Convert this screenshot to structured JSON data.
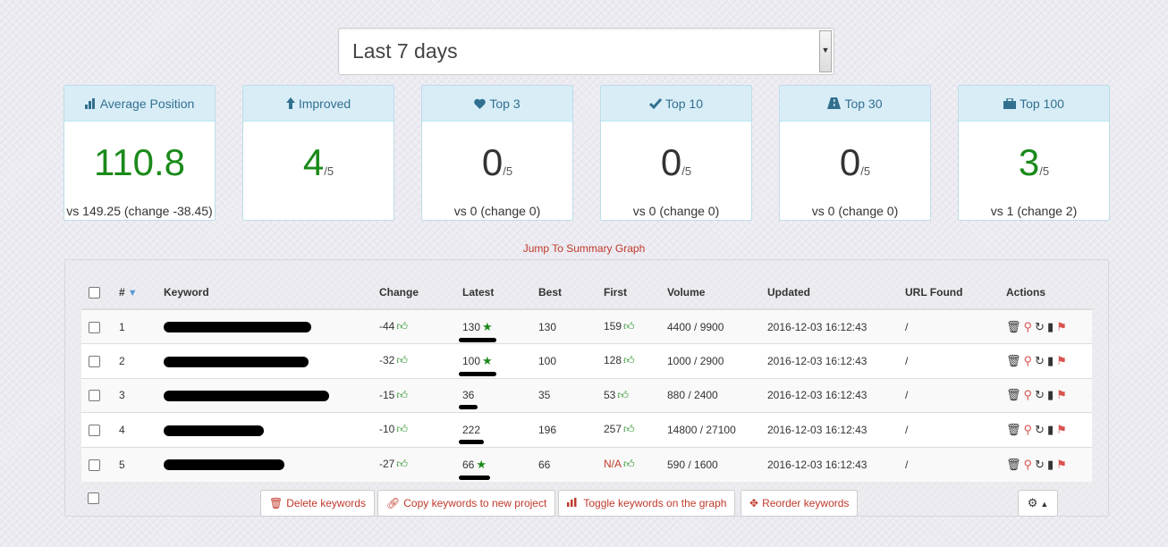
{
  "range": {
    "value": "Last 7 days"
  },
  "cards": [
    {
      "title": "Average Position",
      "icon": "bar-chart-icon",
      "value": "110.8",
      "denom": "",
      "sub": "vs 149.25 (change -38.45)",
      "color": "#1a8a1a"
    },
    {
      "title": "Improved",
      "icon": "arrow-up-icon",
      "value": "4",
      "denom": "/5",
      "sub": "",
      "color": "#1a8a1a"
    },
    {
      "title": "Top 3",
      "icon": "heart-icon",
      "value": "0",
      "denom": "/5",
      "sub": "vs 0 (change 0)",
      "color": "#333333"
    },
    {
      "title": "Top 10",
      "icon": "check-icon",
      "value": "0",
      "denom": "/5",
      "sub": "vs 0 (change 0)",
      "color": "#333333"
    },
    {
      "title": "Top 30",
      "icon": "road-icon",
      "value": "0",
      "denom": "/5",
      "sub": "vs 0 (change 0)",
      "color": "#333333"
    },
    {
      "title": "Top 100",
      "icon": "briefcase-icon",
      "value": "3",
      "denom": "/5",
      "sub": "vs 1 (change 2)",
      "color": "#1a8a1a"
    }
  ],
  "jump_link": "Jump To Summary Graph",
  "table": {
    "headers": {
      "num": "#",
      "keyword": "Keyword",
      "change": "Change",
      "latest": "Latest",
      "best": "Best",
      "first": "First",
      "volume": "Volume",
      "updated": "Updated",
      "url": "URL Found",
      "actions": "Actions"
    },
    "rows": [
      {
        "num": "1",
        "change": "-44",
        "latest": "130",
        "latest_star": true,
        "best": "130",
        "first": "159",
        "volume": "4400 / 9900",
        "updated": "2016-12-03 16:12:43",
        "url": "/"
      },
      {
        "num": "2",
        "change": "-32",
        "latest": "100",
        "latest_star": true,
        "best": "100",
        "first": "128",
        "volume": "1000 / 2900",
        "updated": "2016-12-03 16:12:43",
        "url": "/"
      },
      {
        "num": "3",
        "change": "-15",
        "latest": "36",
        "latest_star": false,
        "best": "35",
        "first": "53",
        "volume": "880 / 2400",
        "updated": "2016-12-03 16:12:43",
        "url": "/"
      },
      {
        "num": "4",
        "change": "-10",
        "latest": "222",
        "latest_star": false,
        "best": "196",
        "first": "257",
        "volume": "14800 / 27100",
        "updated": "2016-12-03 16:12:43",
        "url": "/"
      },
      {
        "num": "5",
        "change": "-27",
        "latest": "66",
        "latest_star": true,
        "best": "66",
        "first": "N/A",
        "volume": "590 / 1600",
        "updated": "2016-12-03 16:12:43",
        "url": "/"
      }
    ]
  },
  "buttons": {
    "delete": "Delete keywords",
    "copy": "Copy keywords to new project",
    "toggle": "Toggle keywords on the graph",
    "reorder": "Reorder keywords"
  },
  "colors": {
    "accent_red": "#c0392b",
    "green": "#1a8a1a",
    "card_head": "#d9edf7"
  }
}
